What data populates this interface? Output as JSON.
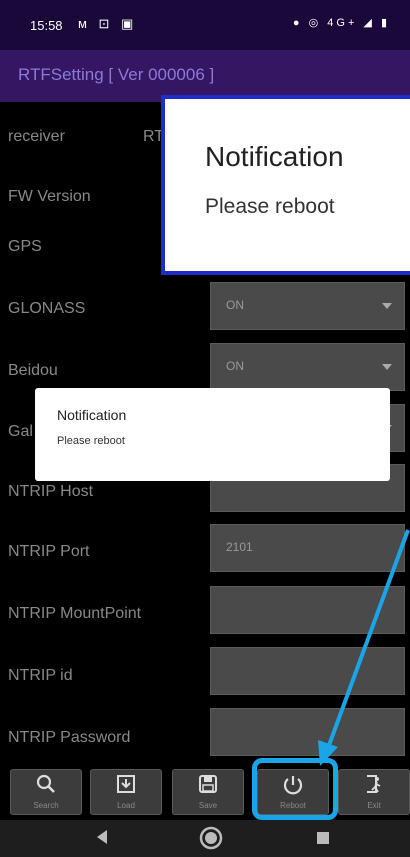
{
  "status_bar": {
    "time": "15:58",
    "left_icons": "ᴍ ⊡ ▣",
    "right_icons": "● ◎ 4G+ ◢ ▮"
  },
  "app": {
    "title": "RTFSetting  [ Ver 000006 ]"
  },
  "fields": [
    {
      "label": "receiver",
      "value": ""
    },
    {
      "label": "FW Version",
      "value": ""
    },
    {
      "label": "GPS",
      "value": ""
    },
    {
      "label": "GLONASS",
      "value": "ON"
    },
    {
      "label": "Beidou",
      "value": "ON"
    },
    {
      "label": "Gal",
      "value": ""
    },
    {
      "label": "NTRIP Host",
      "value": ""
    },
    {
      "label": "NTRIP Port",
      "value": "2101"
    },
    {
      "label": "NTRIP MountPoint",
      "value": ""
    },
    {
      "label": "NTRIP id",
      "value": ""
    },
    {
      "label": "NTRIP Password",
      "value": ""
    }
  ],
  "receiver_partial": "RT",
  "zoom_dialog": {
    "title": "Notification",
    "message": "Please reboot"
  },
  "dialog": {
    "title": "Notification",
    "message": "Please reboot"
  },
  "toolbar": {
    "search": {
      "label": "Search",
      "icon": "search-icon"
    },
    "load": {
      "label": "Load",
      "icon": "download-icon"
    },
    "save": {
      "label": "Save",
      "icon": "floppy-icon"
    },
    "reboot": {
      "label": "Reboot",
      "icon": "power-icon"
    },
    "exit": {
      "label": "Exit",
      "icon": "exit-icon"
    }
  },
  "nav": {
    "back": "back-icon",
    "home": "home-icon",
    "recents": "recents-icon"
  },
  "colors": {
    "status_bar": "#1b083a",
    "title_bar": "#341663",
    "highlight": "#19a5e8",
    "dialog_border": "#1d2ec8"
  }
}
